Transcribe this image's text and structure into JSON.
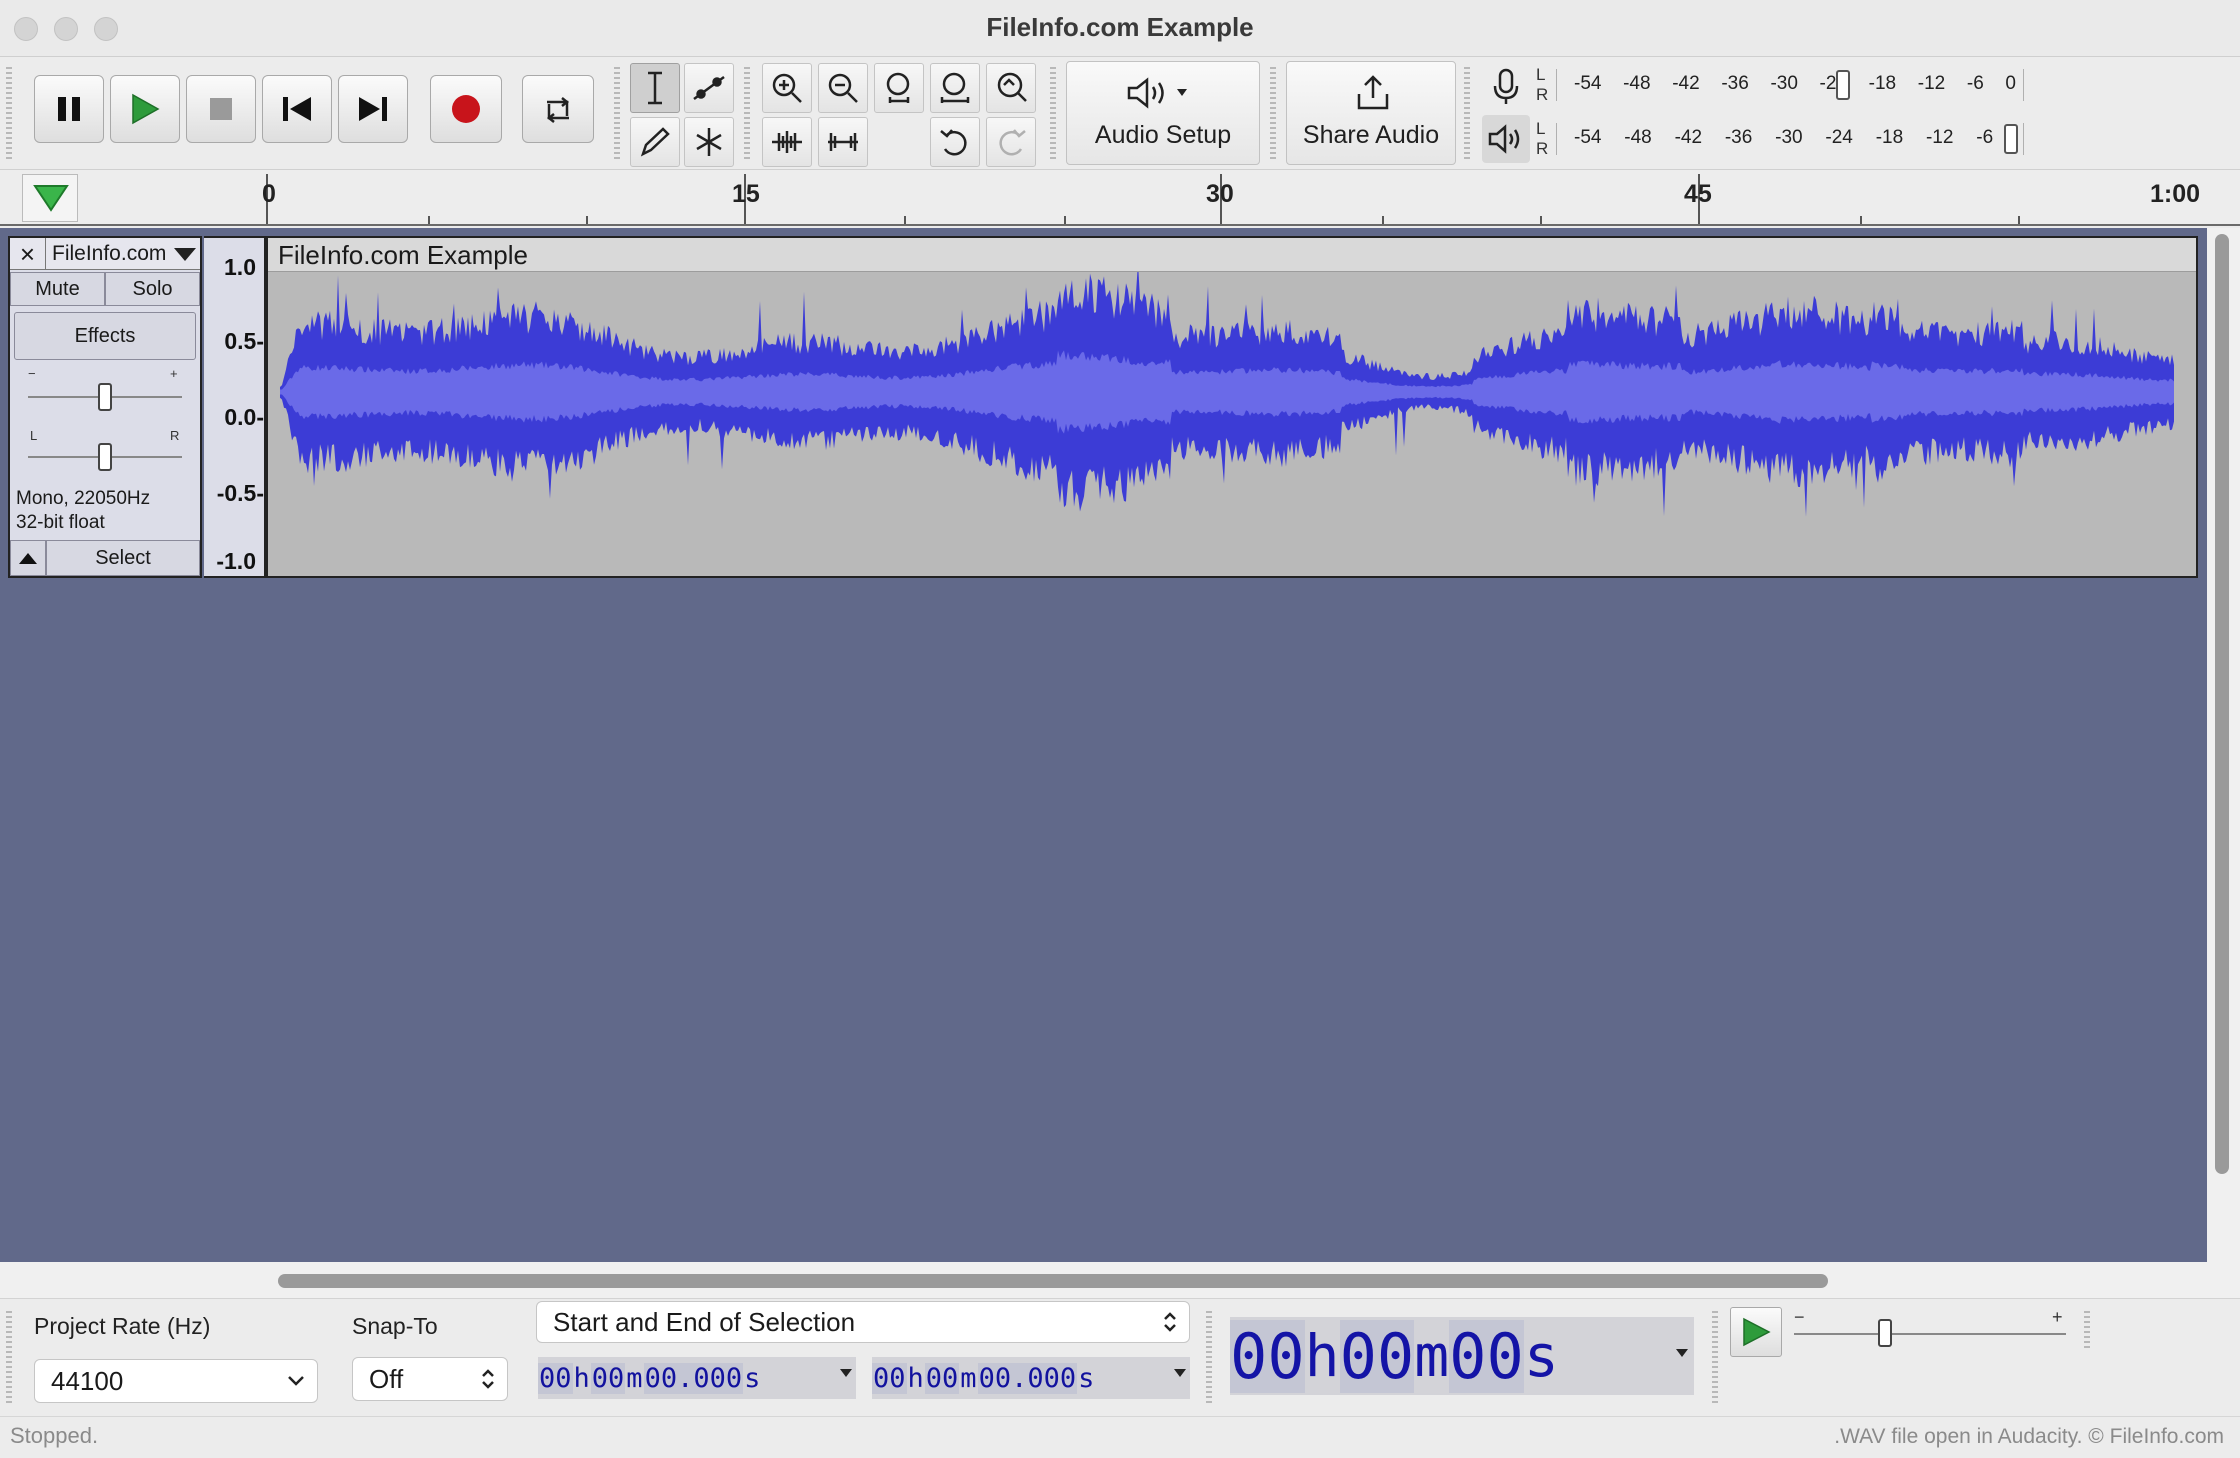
{
  "window": {
    "title": "FileInfo.com Example"
  },
  "toolbar": {
    "audio_setup_label": "Audio Setup",
    "share_audio_label": "Share Audio",
    "record_meter": {
      "ticks": [
        "-54",
        "-48",
        "-42",
        "-36",
        "-30",
        "-24",
        "-18",
        "-12",
        "-6",
        "0"
      ],
      "left_label": "L",
      "right_label": "R"
    },
    "play_meter": {
      "ticks": [
        "-54",
        "-48",
        "-42",
        "-36",
        "-30",
        "-24",
        "-18",
        "-12",
        "-6",
        ""
      ],
      "left_label": "L",
      "right_label": "R"
    }
  },
  "timeline": {
    "labels": [
      "0",
      "15",
      "30",
      "45",
      "1:00"
    ]
  },
  "track": {
    "name": "FileInfo.com",
    "close_label": "×",
    "mute_label": "Mute",
    "solo_label": "Solo",
    "effects_label": "Effects",
    "gain_minus": "−",
    "gain_plus": "+",
    "pan_left": "L",
    "pan_right": "R",
    "info_line1": "Mono, 22050Hz",
    "info_line2": "32-bit float",
    "select_label": "Select",
    "clip_name": "FileInfo.com Example",
    "scale": [
      "1.0",
      "0.5-",
      "0.0-",
      "-0.5-",
      "-1.0"
    ],
    "waveform_color": "#3c3cd6",
    "waveform_rms_color": "#6a6ae8"
  },
  "selection_toolbar": {
    "project_rate_label": "Project Rate (Hz)",
    "project_rate_value": "44100",
    "snap_label": "Snap-To",
    "snap_value": "Off",
    "selection_mode": "Start and End of Selection",
    "start_time": {
      "h": "00",
      "m": "00",
      "s": "00.000",
      "h_unit": "h",
      "m_unit": "m",
      "s_unit": "s"
    },
    "end_time": {
      "h": "00",
      "m": "00",
      "s": "00.000",
      "h_unit": "h",
      "m_unit": "m",
      "s_unit": "s"
    },
    "audio_position": {
      "h": "00",
      "m": "00",
      "s": "00",
      "h_unit": "h",
      "m_unit": "m",
      "s_unit": "s"
    },
    "speed_minus": "−",
    "speed_plus": "+"
  },
  "status": {
    "left": "Stopped.",
    "right": ".WAV file open in Audacity. © FileInfo.com"
  }
}
